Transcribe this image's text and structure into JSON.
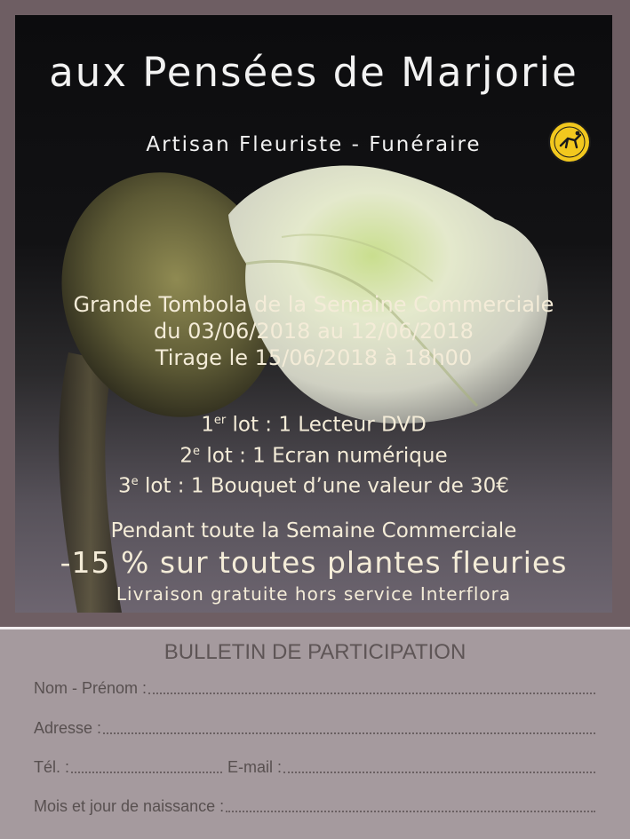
{
  "poster": {
    "title": "aux Pensées de Marjorie",
    "subtitle": "Artisan Fleuriste - Funéraire",
    "logo_text": "INTERFLORA",
    "tombola": {
      "line1": "Grande Tombola de la Semaine Commerciale",
      "line2": "du 03/06/2018 au 12/06/2018",
      "line3": "Tirage le 15/06/2018 à 18h00"
    },
    "prizes": [
      {
        "num": "1",
        "sup": "er",
        "text": " lot : 1 Lecteur DVD"
      },
      {
        "num": "2",
        "sup": "e",
        "text": " lot : 1 Ecran numérique"
      },
      {
        "num": "3",
        "sup": "e",
        "text": " lot : 1 Bouquet d’une valeur de 30€"
      }
    ],
    "promo": {
      "line1": "Pendant toute la Semaine Commerciale",
      "line2": "-15 % sur toutes plantes fleuries",
      "line3": "Livraison gratuite hors service Interflora"
    }
  },
  "form": {
    "title": "BULLETIN DE PARTICIPATION",
    "name_label": "Nom - Prénom :",
    "address_label": "Adresse :",
    "phone_label": "Tél. :",
    "email_label": "E-mail :",
    "birthday_label": "Mois et jour de naissance :"
  },
  "colors": {
    "frame": "#6e5e63",
    "form_background": "#a59a9e",
    "poster_text": "#f4ecd8",
    "form_text": "#5e5556",
    "logo_yellow": "#f2c81e"
  }
}
